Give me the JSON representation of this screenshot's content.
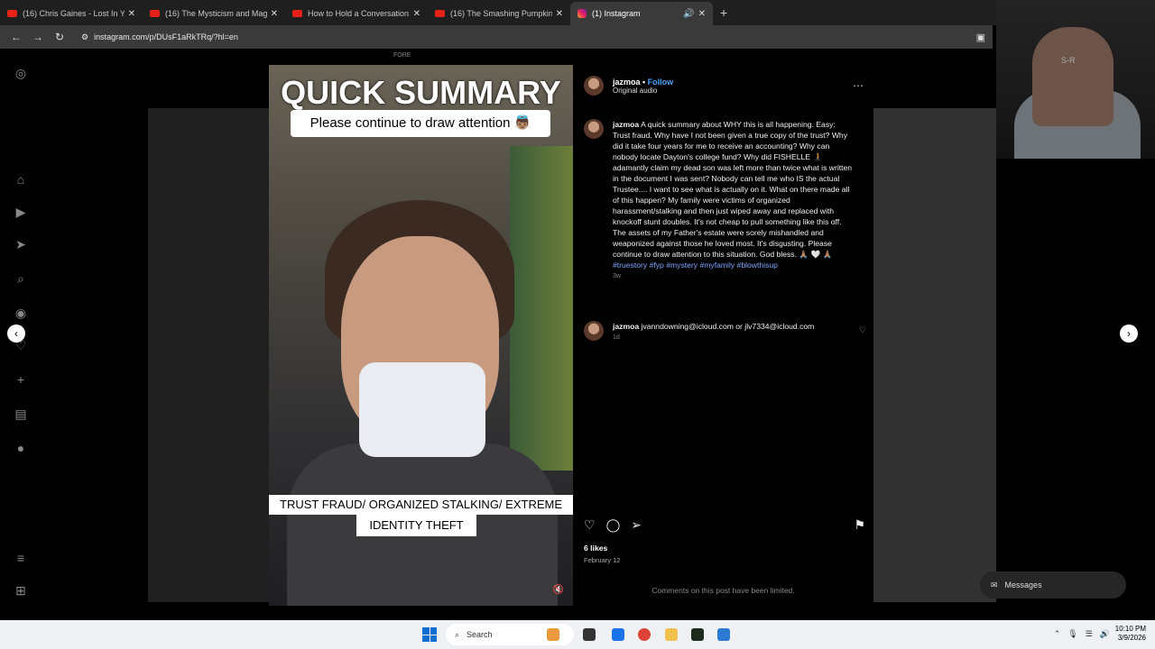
{
  "tabs": [
    {
      "title": "(16) Chris Gaines - Lost In You |"
    },
    {
      "title": "(16) The Mysticism and Magic o"
    },
    {
      "title": "How to Hold a Conversation w"
    },
    {
      "title": "(16) The Smashing Pumpkins -"
    },
    {
      "title": "(1) Instagram"
    }
  ],
  "address": {
    "url": "instagram.com/p/DUsF1aRkTRq/?hl=en"
  },
  "overlay_text": {
    "fore": "FORE"
  },
  "post": {
    "headline": "QUICK SUMMARY",
    "caption_top": "Please continue to draw attention 👼🏽",
    "caption_bottom_1": "TRUST FRAUD/ ORGANIZED STALKING/ EXTREME",
    "caption_bottom_2": "IDENTITY THEFT",
    "author": "jazmoa",
    "follow": "Follow",
    "audio": "Original audio",
    "description_author": "jazmoa",
    "description": "A quick summary about WHY this is all happening. Easy: Trust fraud. Why have I not been given a true copy of the trust? Why did it take four years for me to receive an accounting? Why can nobody locate Dayton's college fund? Why did FISHELLE 🧑‍🦯 adamantly claim my dead son was left more than twice what is written in the document I was sent? Nobody can tell me who IS the actual Trustee.... I want to see what is actually on it. What on there made all of this happen? My family were victims of organized harassment/stalking and then just wiped away and replaced with knockoff stunt doubles. It's not cheap to pull something like this off. The assets of my Father's estate were sorely mishandled and weaponized against those he loved most. It's disgusting. Please continue to draw attention to this situation. God bless. 🙏🏽 🤍 🙏🏽",
    "hashtags": "#truestory #fyp #mystery #myfamily #blowthisup",
    "description_age": "3w",
    "comment_author": "jazmoa",
    "comment_text": "jvanndowning@icloud.com or jlv7334@icloud.com",
    "comment_age": "1d",
    "likes": "6 likes",
    "date": "February 12",
    "comments_limited": "Comments on this post have been limited."
  },
  "messages_label": "Messages",
  "webcam_label": "S-R",
  "taskbar": {
    "search_placeholder": "Search",
    "time": "10:10 PM",
    "date": "3/9/2026"
  },
  "colors": {
    "accent": "#4aa3ff",
    "tab_bg": "#1f1f1f",
    "active_tab": "#3a3a3a"
  }
}
